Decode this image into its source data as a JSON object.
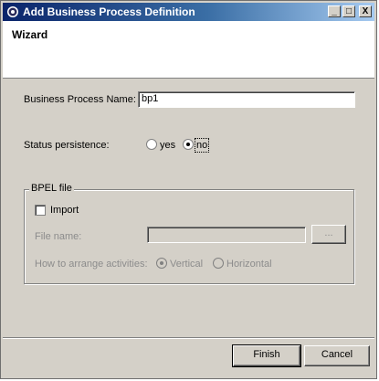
{
  "window": {
    "title": "Add Business Process Definition",
    "minimize": "_",
    "maximize": "□",
    "close": "X",
    "app_icon": "eclipse-icon"
  },
  "header": {
    "heading": "Wizard"
  },
  "form": {
    "bp_name_label": "Business Process Name:",
    "bp_name_value": "bp1",
    "status_label": "Status persistence:",
    "status_yes": "yes",
    "status_no": "no",
    "status_selected": "no"
  },
  "bpel": {
    "group_title": "BPEL file",
    "import_label": "Import",
    "import_checked": false,
    "file_name_label": "File name:",
    "file_name_value": "",
    "browse_label": "...",
    "arrange_label": "How to arrange activities:",
    "vertical_label": "Vertical",
    "horizontal_label": "Horizontal",
    "arrange_selected": "Vertical"
  },
  "footer": {
    "finish_label": "Finish",
    "cancel_label": "Cancel"
  }
}
